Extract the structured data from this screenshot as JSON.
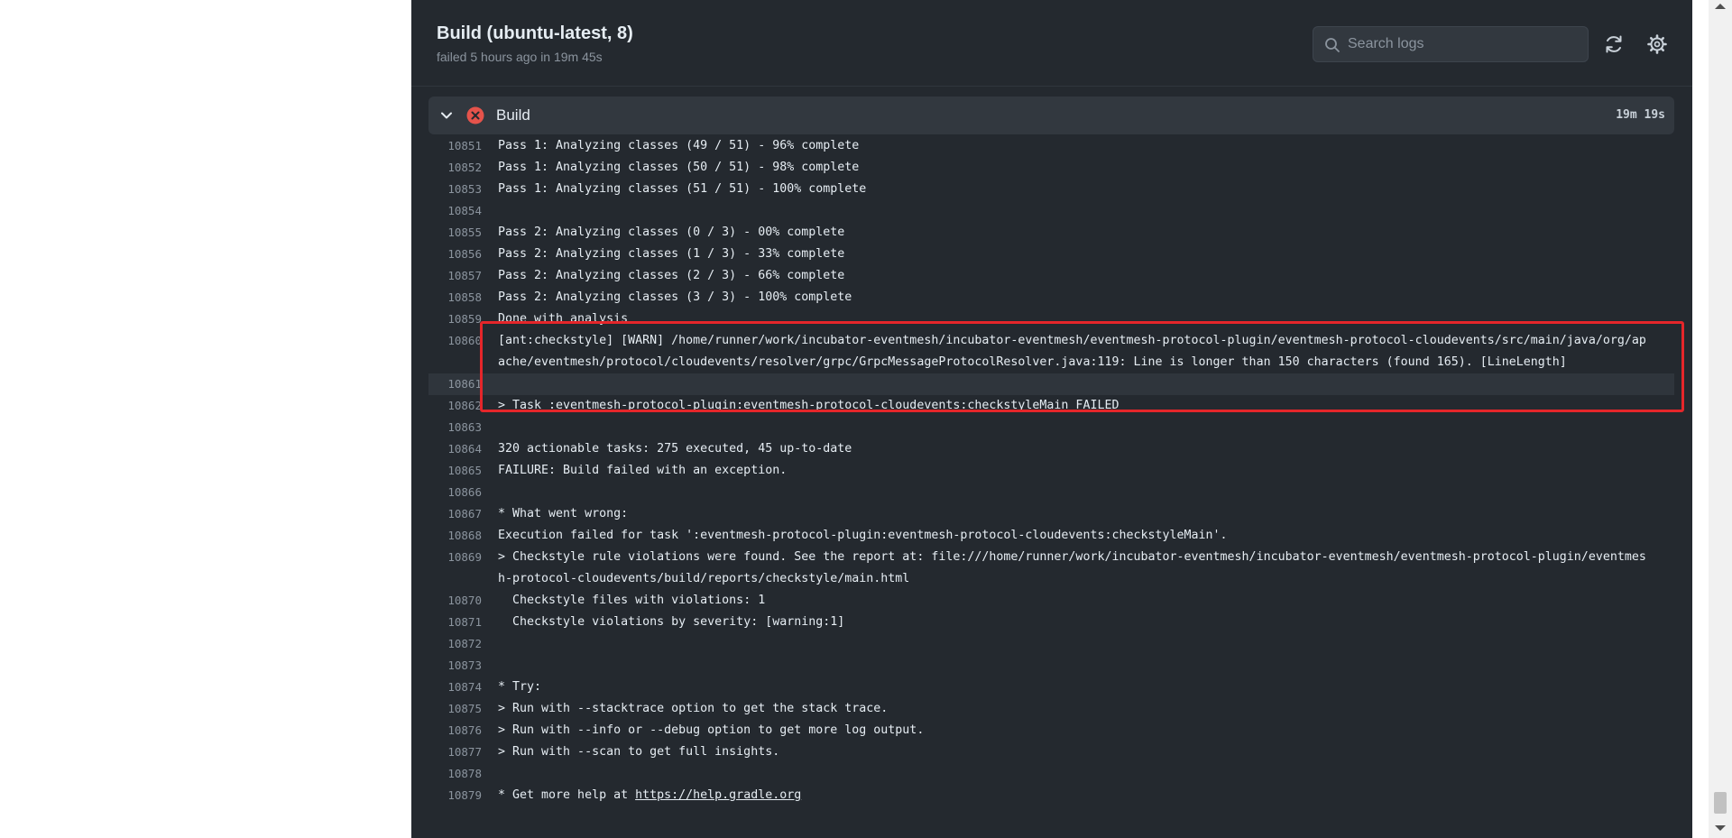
{
  "header": {
    "title": "Build (ubuntu-latest, 8)",
    "meta": "failed 5 hours ago in 19m 45s",
    "search_placeholder": "Search logs",
    "refresh_icon": "refresh-icon",
    "settings_icon": "gear-icon"
  },
  "step": {
    "name": "Build",
    "duration": "19m 19s",
    "status": "failed",
    "status_color": "#e5534b"
  },
  "log": [
    {
      "n": "10851",
      "t": "Pass 1: Analyzing classes (49 / 51) - 96% complete"
    },
    {
      "n": "10852",
      "t": "Pass 1: Analyzing classes (50 / 51) - 98% complete"
    },
    {
      "n": "10853",
      "t": "Pass 1: Analyzing classes (51 / 51) - 100% complete"
    },
    {
      "n": "10854",
      "t": ""
    },
    {
      "n": "10855",
      "t": "Pass 2: Analyzing classes (0 / 3) - 00% complete"
    },
    {
      "n": "10856",
      "t": "Pass 2: Analyzing classes (1 / 3) - 33% complete"
    },
    {
      "n": "10857",
      "t": "Pass 2: Analyzing classes (2 / 3) - 66% complete"
    },
    {
      "n": "10858",
      "t": "Pass 2: Analyzing classes (3 / 3) - 100% complete"
    },
    {
      "n": "10859",
      "t": "Done with analysis"
    },
    {
      "n": "10860",
      "t": "[ant:checkstyle] [WARN] /home/runner/work/incubator-eventmesh/incubator-eventmesh/eventmesh-protocol-plugin/eventmesh-protocol-cloudevents/src/main/java/org/apache/eventmesh/protocol/cloudevents/resolver/grpc/GrpcMessageProtocolResolver.java:119: Line is longer than 150 characters (found 165). [LineLength]"
    },
    {
      "n": "10861",
      "t": ""
    },
    {
      "n": "10862",
      "t": "> Task :eventmesh-protocol-plugin:eventmesh-protocol-cloudevents:checkstyleMain FAILED"
    },
    {
      "n": "10863",
      "t": ""
    },
    {
      "n": "10864",
      "t": "320 actionable tasks: 275 executed, 45 up-to-date"
    },
    {
      "n": "10865",
      "t": "FAILURE: Build failed with an exception."
    },
    {
      "n": "10866",
      "t": ""
    },
    {
      "n": "10867",
      "t": "* What went wrong:"
    },
    {
      "n": "10868",
      "t": "Execution failed for task ':eventmesh-protocol-plugin:eventmesh-protocol-cloudevents:checkstyleMain'."
    },
    {
      "n": "10869",
      "t": "> Checkstyle rule violations were found. See the report at: file:///home/runner/work/incubator-eventmesh/incubator-eventmesh/eventmesh-protocol-plugin/eventmesh-protocol-cloudevents/build/reports/checkstyle/main.html"
    },
    {
      "n": "10870",
      "t": "  Checkstyle files with violations: 1"
    },
    {
      "n": "10871",
      "t": "  Checkstyle violations by severity: [warning:1]"
    },
    {
      "n": "10872",
      "t": ""
    },
    {
      "n": "10873",
      "t": ""
    },
    {
      "n": "10874",
      "t": "* Try:"
    },
    {
      "n": "10875",
      "t": "> Run with --stacktrace option to get the stack trace."
    },
    {
      "n": "10876",
      "t": "> Run with --info or --debug option to get more log output."
    },
    {
      "n": "10877",
      "t": "> Run with --scan to get full insights."
    },
    {
      "n": "10878",
      "t": ""
    },
    {
      "n": "10879",
      "t": "* Get more help at ",
      "link": "https://help.gradle.org"
    }
  ]
}
